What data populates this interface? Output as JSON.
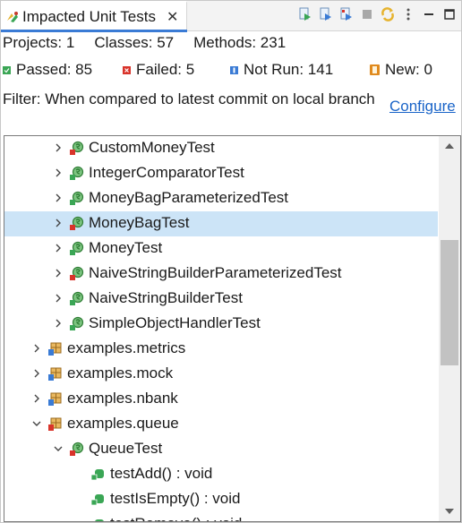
{
  "view": {
    "tab_title": "Impacted Unit Tests",
    "close_glyph": "✕"
  },
  "toolbar": [
    {
      "name": "run-impacted-tests-icon"
    },
    {
      "name": "debug-impacted-tests-icon"
    },
    {
      "name": "run-failed-tests-icon"
    },
    {
      "name": "stop-icon"
    },
    {
      "name": "refresh-icon"
    },
    {
      "name": "view-menu-icon"
    },
    {
      "name": "minimize-icon"
    },
    {
      "name": "maximize-icon"
    }
  ],
  "stats": {
    "projects": "Projects: 1",
    "classes": "Classes: 57",
    "methods": "Methods: 231"
  },
  "status": {
    "passed": "Passed: 85",
    "failed": "Failed: 5",
    "not_run": "Not Run: 141",
    "new": "New: 0"
  },
  "colors": {
    "passed": "#3aa655",
    "failed": "#d9342b",
    "not_run": "#3a7bd5",
    "new": "#e08a1e",
    "selection": "#cce4f7",
    "link": "#1a64c8"
  },
  "filter": {
    "text": "Filter: When compared to latest commit on local branch",
    "configure_label": "Configure"
  },
  "tree": {
    "rows": [
      {
        "label": "CustomMoneyTest",
        "kind": "class-failed",
        "depth": 2,
        "expanded": false
      },
      {
        "label": "IntegerComparatorTest",
        "kind": "class-passed",
        "depth": 2,
        "expanded": false
      },
      {
        "label": "MoneyBagParameterizedTest",
        "kind": "class-passed",
        "depth": 2,
        "expanded": false
      },
      {
        "label": "MoneyBagTest",
        "kind": "class-failed",
        "depth": 2,
        "expanded": false,
        "selected": true
      },
      {
        "label": "MoneyTest",
        "kind": "class-passed",
        "depth": 2,
        "expanded": false
      },
      {
        "label": "NaiveStringBuilderParameterizedTest",
        "kind": "class-failed",
        "depth": 2,
        "expanded": false
      },
      {
        "label": "NaiveStringBuilderTest",
        "kind": "class-passed",
        "depth": 2,
        "expanded": false
      },
      {
        "label": "SimpleObjectHandlerTest",
        "kind": "class-passed",
        "depth": 2,
        "expanded": false
      },
      {
        "label": "examples.metrics",
        "kind": "package-notrun",
        "depth": 1,
        "expanded": false
      },
      {
        "label": "examples.mock",
        "kind": "package-notrun",
        "depth": 1,
        "expanded": false
      },
      {
        "label": "examples.nbank",
        "kind": "package-notrun",
        "depth": 1,
        "expanded": false
      },
      {
        "label": "examples.queue",
        "kind": "package-failed",
        "depth": 1,
        "expanded": true
      },
      {
        "label": "QueueTest",
        "kind": "class-failed",
        "depth": 2,
        "expanded": true
      },
      {
        "label": "testAdd() : void",
        "kind": "method-passed",
        "depth": 3
      },
      {
        "label": "testIsEmpty() : void",
        "kind": "method-passed",
        "depth": 3
      },
      {
        "label": "testRemove() : void",
        "kind": "method-passed",
        "depth": 3
      }
    ]
  }
}
